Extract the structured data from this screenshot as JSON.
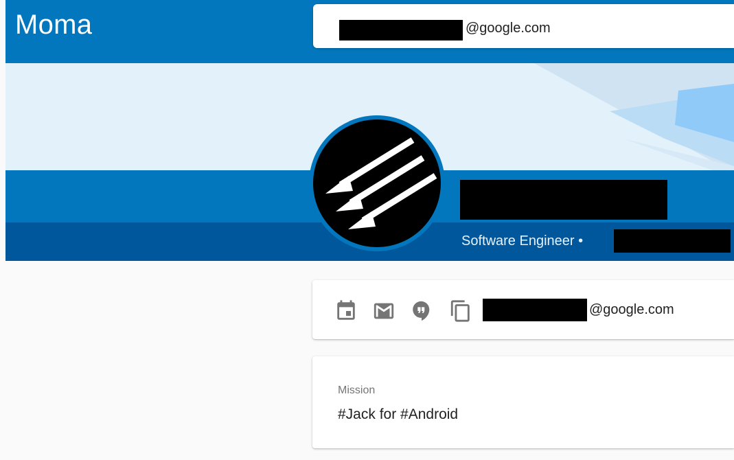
{
  "app": {
    "title": "Moma"
  },
  "header": {
    "search_value_suffix": "@google.com"
  },
  "profile": {
    "subtitle_role": "Software Engineer •"
  },
  "contact": {
    "icons": [
      "calendar-icon",
      "email-icon",
      "chat-icon",
      "copy-icon"
    ],
    "email_suffix": "@google.com"
  },
  "mission": {
    "label": "Mission",
    "text": "#Jack for #Android"
  },
  "colors": {
    "primary": "#0277bd",
    "primary_dark": "#01579b",
    "banner_light": "#e3f1fb",
    "redaction": "#000000"
  }
}
